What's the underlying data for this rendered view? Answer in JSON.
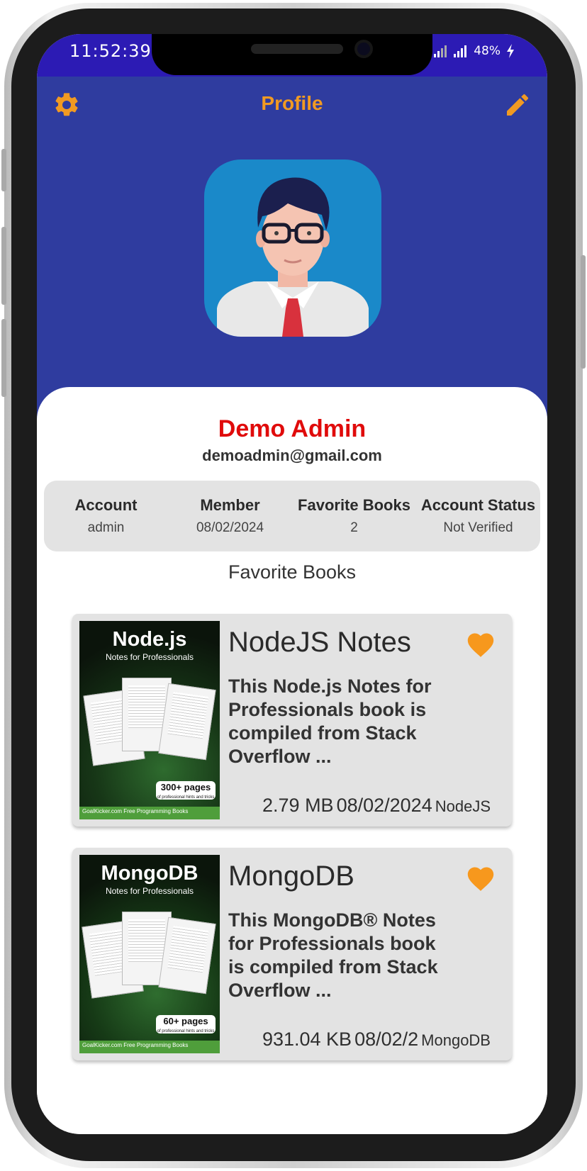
{
  "status_bar": {
    "time": "11:52:39",
    "battery": "48%"
  },
  "header": {
    "title": "Profile",
    "settings_icon": "gear-icon",
    "edit_icon": "pencil-icon"
  },
  "profile": {
    "name": "Demo Admin",
    "email": "demoadmin@gmail.com"
  },
  "stats": [
    {
      "label": "Account",
      "value": "admin"
    },
    {
      "label": "Member",
      "value": "08/02/2024"
    },
    {
      "label": "Favorite Books",
      "value": "2"
    },
    {
      "label": "Account Status",
      "value": "Not Verified"
    }
  ],
  "favorites": {
    "heading": "Favorite Books",
    "books": [
      {
        "title": "NodeJS Notes",
        "description": "This Node.js Notes for Professionals book is compiled from Stack Overflow ...",
        "size": "2.79 MB",
        "date": "08/02/2024",
        "tag": "NodeJS",
        "cover_title": "Node.js",
        "cover_subtitle": "Notes for Professionals",
        "cover_pages": "300+ pages",
        "cover_pages_sub": "of professional hints and tricks",
        "cover_footer": "GoalKicker.com Free Programming Books",
        "favorited": true
      },
      {
        "title": "MongoDB",
        "description": "This MongoDB® Notes for Professionals book is compiled from Stack Overflow ...",
        "size": "931.04 KB",
        "date": "08/02/2",
        "tag": "MongoDB",
        "cover_title": "MongoDB",
        "cover_subtitle": "Notes for Professionals",
        "cover_pages": "60+ pages",
        "cover_pages_sub": "of professional hints and tricks",
        "cover_footer": "GoalKicker.com Free Programming Books",
        "favorited": true
      }
    ]
  },
  "colors": {
    "header": "#2f3c9f",
    "accent": "#f19a22",
    "name": "#e00b0b",
    "status_bar": "#2c1bb4"
  }
}
